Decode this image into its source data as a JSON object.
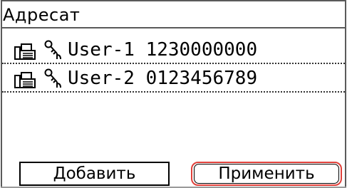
{
  "screen": {
    "title": "Адресат"
  },
  "recipients": [
    {
      "type_icon": "fax-icon",
      "lock_icon": "key-icon",
      "name": "User-1",
      "number": "1230000000",
      "display": "User-1 1230000000"
    },
    {
      "type_icon": "fax-icon",
      "lock_icon": "key-icon",
      "name": "User-2",
      "number": "0123456789",
      "display": "User-2 0123456789"
    }
  ],
  "buttons": {
    "add_label": "Добавить",
    "apply_label": "Применить"
  },
  "colors": {
    "focus_outline": "#e0403a",
    "border": "#5a5a5a"
  }
}
